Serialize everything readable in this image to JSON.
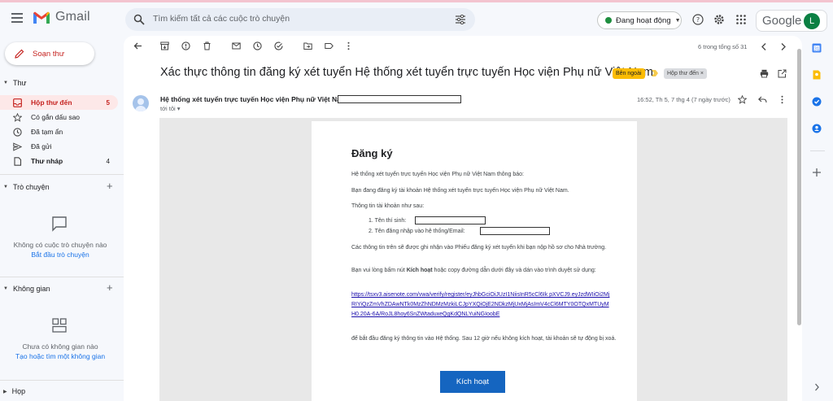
{
  "app": {
    "name": "Gmail",
    "search_placeholder": "Tìm kiếm tất cả các cuộc trò chuyện",
    "status_label": "Đang hoạt động",
    "google_label": "Google",
    "avatar_letter": "L"
  },
  "sidebar": {
    "compose_label": "Soạn thư",
    "mail_section": "Thư",
    "items": [
      {
        "label": "Hộp thư đến",
        "count": "5",
        "icon": "inbox-icon"
      },
      {
        "label": "Có gắn dấu sao",
        "count": "",
        "icon": "star-icon"
      },
      {
        "label": "Đã tạm ẩn",
        "count": "",
        "icon": "clock-icon"
      },
      {
        "label": "Đã gửi",
        "count": "",
        "icon": "send-icon"
      },
      {
        "label": "Thư nháp",
        "count": "4",
        "icon": "draft-icon"
      }
    ],
    "chat_section": "Trò chuyện",
    "chat_empty": "Không có cuộc trò chuyện nào",
    "chat_start": "Bắt đầu trò chuyện",
    "spaces_section": "Không gian",
    "spaces_empty": "Chưa có không gian nào",
    "spaces_create": "Tạo hoặc tìm một không gian",
    "meet_section": "Họp"
  },
  "toolbar": {
    "pager": "6 trong tổng số 31"
  },
  "message": {
    "subject": "Xác thực thông tin đăng ký xét tuyển Hệ thống xét tuyển trực tuyến Học viện Phụ nữ Việt Nam",
    "label_external": "Bên ngoài",
    "label_inbox": "Hộp thư đến",
    "label_inbox_close": "×",
    "sender": "Hệ thống xét tuyển trực tuyến Học viện Phụ nữ Việt Nam",
    "to": "tới tôi",
    "date": "16:52, Th 5, 7 thg 4 (7 ngày trước)"
  },
  "email": {
    "heading": "Đăng ký",
    "p1": "Hệ thống xét tuyển trực tuyến Học viện Phụ nữ Việt Nam thông báo:",
    "p2": "Bạn đang đăng ký tài khoản Hệ thống xét tuyển trực tuyến Học viện Phụ nữ Việt Nam.",
    "p3": "Thông tin tài khoản như sau:",
    "li1": "1. Tên thí sinh:",
    "li2": "2. Tên đăng nhập vào hệ thống/Email:",
    "p4": "Các thông tin trên sẽ được ghi nhận vào Phiếu đăng ký xét tuyển khi bạn nộp hồ sơ cho Nhà trường.",
    "p5a": "Bạn vui lòng bấm nút ",
    "p5b": "Kích hoạt",
    "p5c": " hoặc copy đường dẫn dưới đây và dán vào trình duyệt sử dụng:",
    "link": "https://tsxv3.aisenote.com/vwa/verify/register/eyJhbGciOiJUzI1NiisInR5cCl6Ik pXVCJ9.eyJzdWIiOi2MjRIYiQzZmVhZDAwNTk0MzZhNDMzMzkiLCJpYXQiOjE2NDkzMjUxMjAsImV4cCl6MTY0OTQxMTUyMH0.20A-6A/RoJL8hoy6SnZWtaduxeQgKdQNLYuiNGIoobE",
    "p6": "để bắt đầu đăng ký thông tin vào Hệ thống. Sau 12 giờ nếu không kích hoạt, tài khoản sẽ tự động bị xoá.",
    "activate_label": "Kích hoạt"
  },
  "colors": {
    "accent_red": "#c5221f",
    "active_bg": "#fde8e8",
    "button_blue": "#1565c0",
    "external_chip": "#fbbc04"
  }
}
